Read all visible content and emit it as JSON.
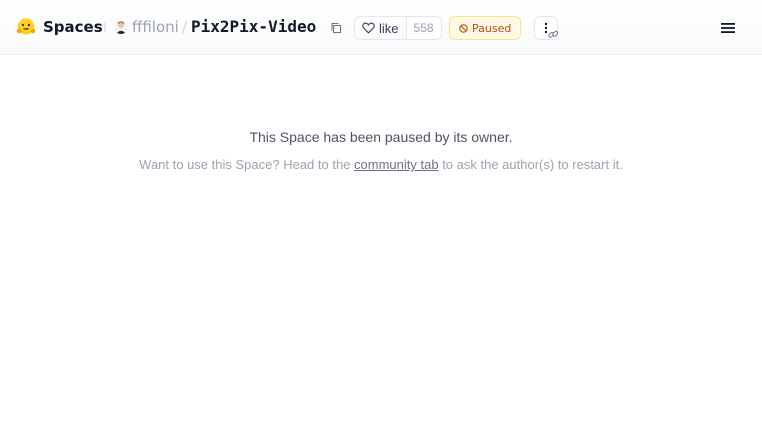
{
  "header": {
    "brand_label": "Spaces",
    "brand_icon": "hugging-face-emoji-icon",
    "owner_name": "fffiloni",
    "separator": "/",
    "repo_name": "Pix2Pix-Video",
    "like_label": "like",
    "like_count": "558",
    "status_label": "Paused",
    "accent_colors": {
      "brand_yellow": "#FFD21E",
      "status_bg": "#fef9e7",
      "status_text": "#b45309"
    }
  },
  "main": {
    "title": "This Space has been paused by its owner.",
    "subtitle_before": "Want to use this Space? Head to the ",
    "subtitle_link": "community tab",
    "subtitle_after": " to ask the author(s) to restart it."
  }
}
